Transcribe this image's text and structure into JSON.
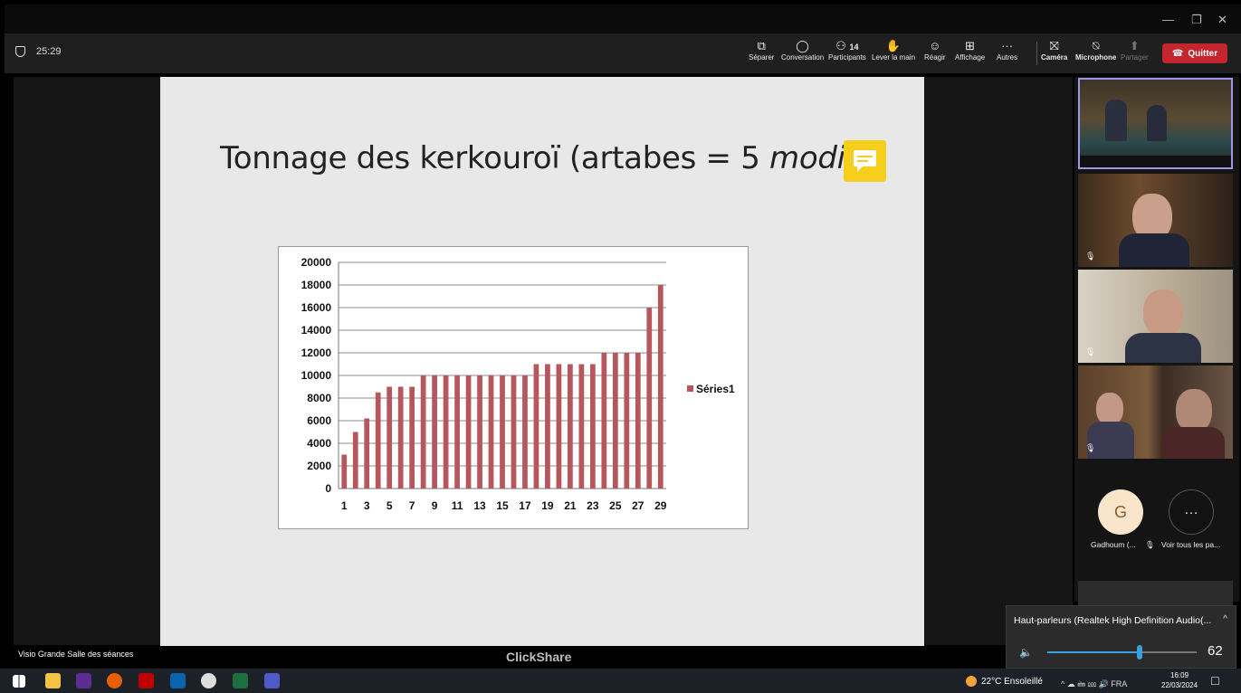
{
  "window": {
    "min_glyph": "—",
    "restore_glyph": "❐",
    "close_glyph": "✕"
  },
  "toolbar": {
    "timer": "25:29",
    "buttons": [
      {
        "label": "Séparer",
        "icon": "pop-out-icon",
        "glyph": "⧉"
      },
      {
        "label": "Conversation",
        "icon": "chat-icon",
        "glyph": "💬"
      },
      {
        "label": "Participants",
        "icon": "people-icon",
        "glyph": "👤",
        "badge": "14"
      },
      {
        "label": "Lever la main",
        "icon": "raise-hand-icon",
        "glyph": "✋"
      },
      {
        "label": "Réagir",
        "icon": "smile-icon",
        "glyph": "☺"
      },
      {
        "label": "Affichage",
        "icon": "grid-icon",
        "glyph": "⊞"
      },
      {
        "label": "Autres",
        "icon": "more-icon",
        "glyph": "···"
      },
      {
        "label": "Caméra",
        "icon": "camera-off-icon",
        "glyph": "▶"
      },
      {
        "label": "Microphone",
        "icon": "mic-off-icon",
        "glyph": "🎙"
      },
      {
        "label": "Partager",
        "icon": "share-icon",
        "glyph": "⬆"
      }
    ],
    "quit_label": "Quitter",
    "quit_color": "#c4262e"
  },
  "slide": {
    "title_main": "Tonnage des kerkouroï (artabes = 5 ",
    "title_italic": "modii",
    "title_end": ")",
    "note_icon": "comment-icon",
    "accent": "#f6cf1d"
  },
  "chart_data": {
    "type": "bar",
    "categories": [
      "1",
      "2",
      "3",
      "4",
      "5",
      "6",
      "7",
      "8",
      "9",
      "10",
      "11",
      "12",
      "13",
      "14",
      "15",
      "16",
      "17",
      "18",
      "19",
      "20",
      "21",
      "22",
      "23",
      "24",
      "25",
      "26",
      "27",
      "28",
      "29"
    ],
    "x_tick_labels": [
      "1",
      "3",
      "5",
      "7",
      "9",
      "11",
      "13",
      "15",
      "17",
      "19",
      "21",
      "23",
      "25",
      "27",
      "29"
    ],
    "series": [
      {
        "name": "Séries1",
        "color": "#b5575c",
        "values": [
          3000,
          5000,
          6200,
          8500,
          9000,
          9000,
          9000,
          10000,
          10000,
          10000,
          10000,
          10000,
          10000,
          10000,
          10000,
          10000,
          10000,
          11000,
          11000,
          11000,
          11000,
          11000,
          11000,
          12000,
          12000,
          12000,
          12000,
          16000,
          18000
        ]
      }
    ],
    "ylim": [
      0,
      20000
    ],
    "y_ticks": [
      "0",
      "2000",
      "4000",
      "6000",
      "8000",
      "10000",
      "12000",
      "14000",
      "16000",
      "18000",
      "20000"
    ],
    "grid": true,
    "legend": "right",
    "title": "",
    "xlabel": "",
    "ylabel": ""
  },
  "stage": {
    "watermark": "ClickShare",
    "room_label": "Visio Grande Salle des séances"
  },
  "participants": {
    "avatar_initial": "G",
    "avatar_name": "Gadhoum (...",
    "see_all_label": "Voir tous les pa...",
    "more_glyph": "···"
  },
  "volume": {
    "device": "Haut-parleurs (Realtek High Definition Audio(...",
    "level": 62,
    "value_text": "62",
    "caret": "^"
  },
  "taskbar": {
    "weather": "22°C Ensoleillé",
    "tray_text": "^ ☁ 🖮 ⅏ 🔊 FRA",
    "time": "16:09",
    "date": "22/03/2024",
    "notif_glyph": "☐"
  }
}
